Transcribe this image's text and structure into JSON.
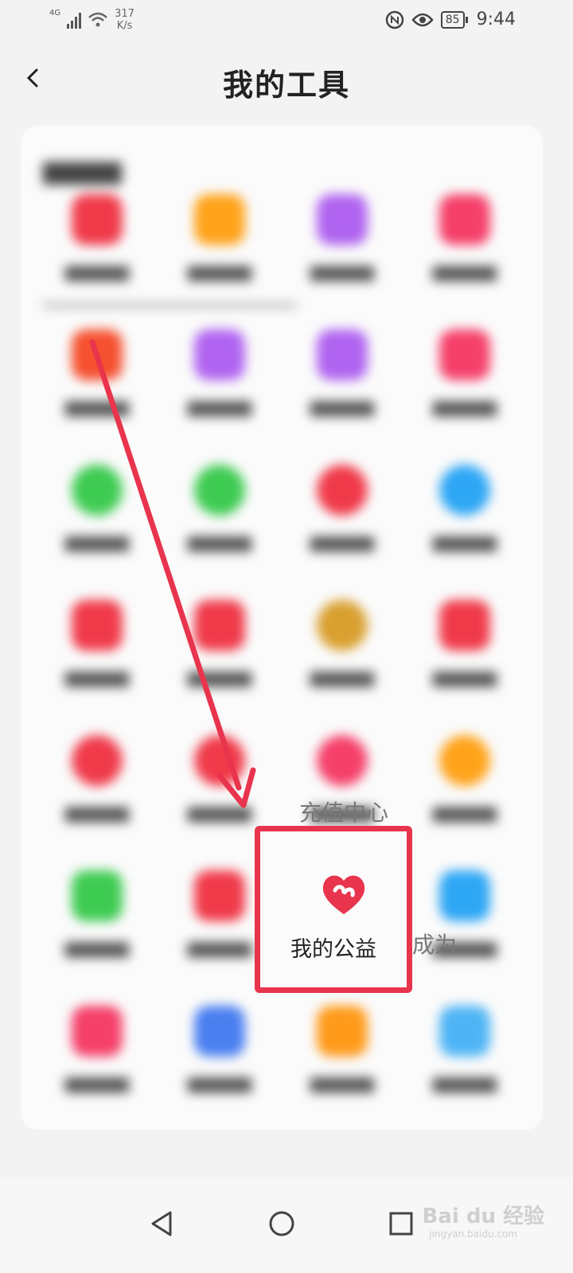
{
  "status": {
    "network": "4G",
    "speed_value": "317",
    "speed_unit": "K/s",
    "battery": "85",
    "time": "9:44"
  },
  "header": {
    "back_icon": "chevron-left-icon",
    "title": "我的工具"
  },
  "highlighted": {
    "label": "我的公益",
    "icon": "heart-icon",
    "accent_color": "#e8344d"
  },
  "visible_labels": {
    "recharge_center": "充值中心",
    "become_partial": "成为"
  },
  "colors": {
    "annotation_red": "#e8344d",
    "background": "#f3f3f3",
    "card": "#fbfbfb"
  },
  "watermark": {
    "text": "Bai du 经验",
    "sub": "jingyan.baidu.com"
  }
}
